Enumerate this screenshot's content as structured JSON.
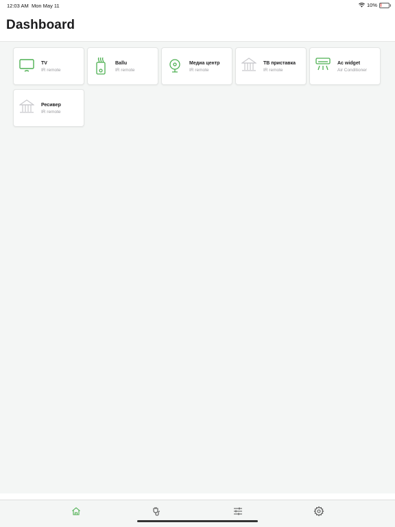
{
  "status_bar": {
    "time": "12:03 AM",
    "date": "Mon May 11",
    "battery": "10%",
    "battery_level": 0.1
  },
  "header": {
    "title": "Dashboard"
  },
  "devices": [
    {
      "name": "TV",
      "type": "IR remote",
      "icon": "tv-icon",
      "icon_color": "#4caf50"
    },
    {
      "name": "Ballu",
      "type": "IR remote",
      "icon": "heater-icon",
      "icon_color": "#4caf50"
    },
    {
      "name": "Медиа центр",
      "type": "IR remote",
      "icon": "media-center-icon",
      "icon_color": "#4caf50"
    },
    {
      "name": "ТВ приставка",
      "type": "IR remote",
      "icon": "building-icon",
      "icon_color": "#c8c8cc"
    },
    {
      "name": "Ac widget",
      "type": "Air Conditioner",
      "icon": "air-conditioner-icon",
      "icon_color": "#4caf50"
    },
    {
      "name": "Ресивер",
      "type": "IR remote",
      "icon": "building-icon",
      "icon_color": "#c8c8cc"
    }
  ],
  "tab_bar": [
    {
      "name": "home",
      "icon": "home-icon",
      "active": true
    },
    {
      "name": "devices",
      "icon": "plug-icon",
      "active": false
    },
    {
      "name": "controls",
      "icon": "sliders-icon",
      "active": false
    },
    {
      "name": "settings",
      "icon": "gear-icon",
      "active": false
    }
  ],
  "colors": {
    "accent": "#4caf50",
    "inactive": "#555555",
    "background": "#f4f6f5"
  }
}
